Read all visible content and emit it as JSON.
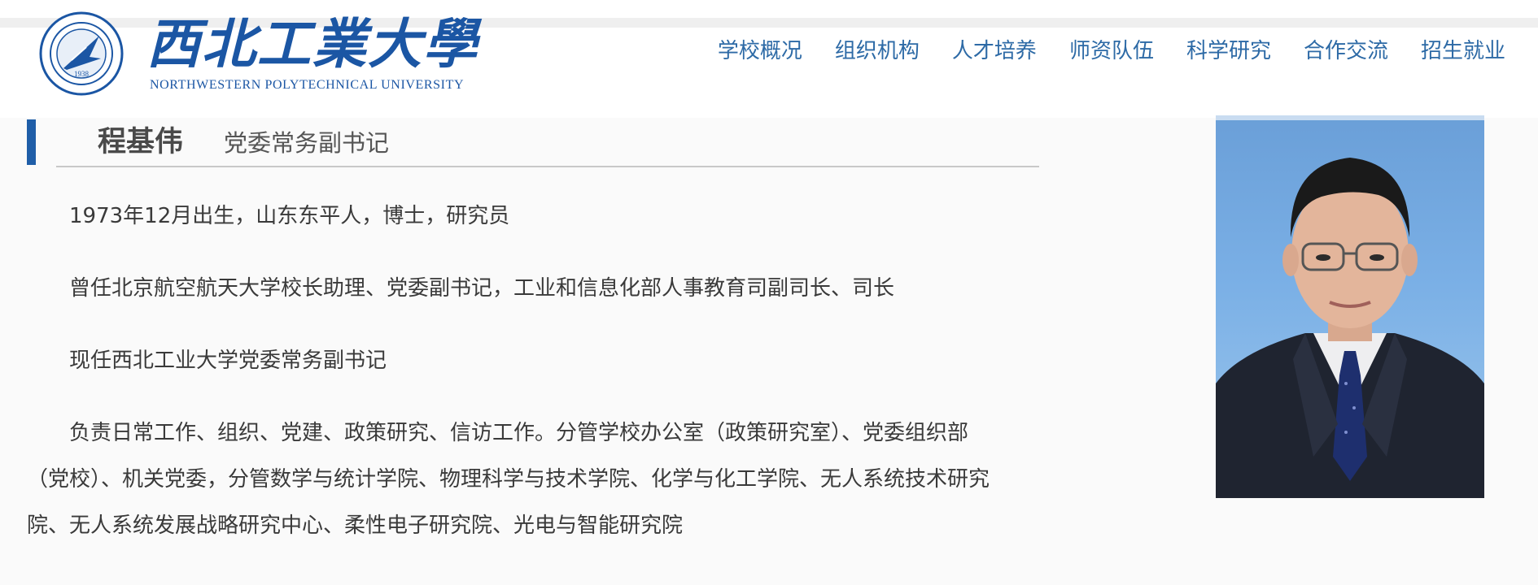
{
  "header": {
    "logo_cn": "西北工業大學",
    "logo_en": "NORTHWESTERN POLYTECHNICAL UNIVERSITY",
    "seal_year": "1938",
    "nav": [
      {
        "label": "学校概况"
      },
      {
        "label": "组织机构"
      },
      {
        "label": "人才培养"
      },
      {
        "label": "师资队伍"
      },
      {
        "label": "科学研究"
      },
      {
        "label": "合作交流"
      },
      {
        "label": "招生就业"
      }
    ]
  },
  "profile": {
    "name": "程基伟",
    "role": "党委常务副书记",
    "paragraphs": [
      "1973年12月出生，山东东平人，博士，研究员",
      "曾任北京航空航天大学校长助理、党委副书记，工业和信息化部人事教育司副司长、司长",
      "现任西北工业大学党委常务副书记",
      "负责日常工作、组织、党建、政策研究、信访工作。分管学校办公室（政策研究室）、党委组织部（党校）、机关党委，分管数学与统计学院、物理科学与技术学院、化学与化工学院、无人系统技术研究院、无人系统发展战略研究中心、柔性电子研究院、光电与智能研究院"
    ]
  },
  "colors": {
    "brand_blue": "#1b56a4",
    "nav_blue": "#2d6aa6",
    "accent_bar": "#1f5ea8"
  }
}
